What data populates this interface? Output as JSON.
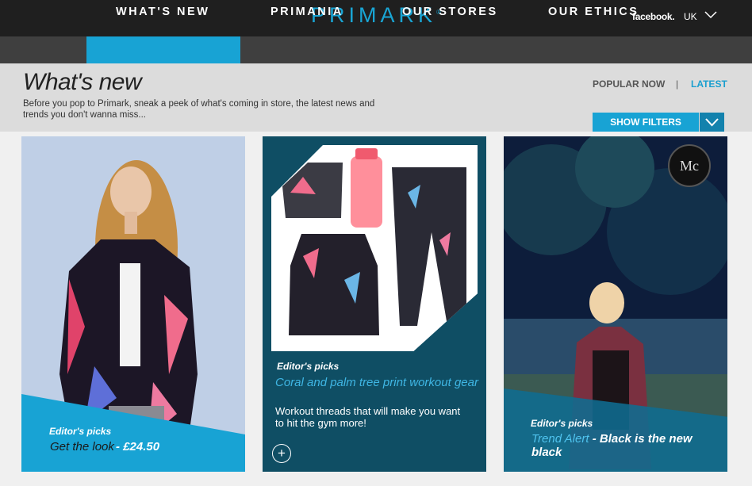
{
  "brand": {
    "logo": "PRIMARK",
    "logo_mark": "®"
  },
  "topbar": {
    "facebook_label": "facebook.",
    "region": "UK"
  },
  "nav": {
    "items": [
      {
        "label": "WHAT'S NEW"
      },
      {
        "label": "PRIMANIA"
      },
      {
        "label": "OUR STORES"
      },
      {
        "label": "OUR ETHICS"
      }
    ]
  },
  "header": {
    "title": "What's new",
    "intro": "Before you pop to Primark, sneak a peek of what's coming in store, the latest news and trends you don't wanna miss...",
    "sort": {
      "popular": "POPULAR NOW",
      "separator": "|",
      "latest": "LATEST"
    },
    "filter_button": "SHOW FILTERS"
  },
  "cards": [
    {
      "eyebrow": "Editor's picks",
      "title": "Get the look",
      "price": " - £24.50"
    },
    {
      "eyebrow": "Editor's picks",
      "title": "Coral and palm tree print workout gear",
      "description": "Workout threads that will make you want to hit the gym more!",
      "plus": "+"
    },
    {
      "eyebrow": "Editor's picks",
      "title_accent": "Trend Alert",
      "title_rest": " - Black is the new black",
      "badge": "Mc"
    }
  ],
  "colors": {
    "brand_blue": "#18a3d4",
    "dark_bar": "#1f1f1f",
    "nav_bar": "#3f3f3f",
    "teal_card": "#0f4e64"
  }
}
